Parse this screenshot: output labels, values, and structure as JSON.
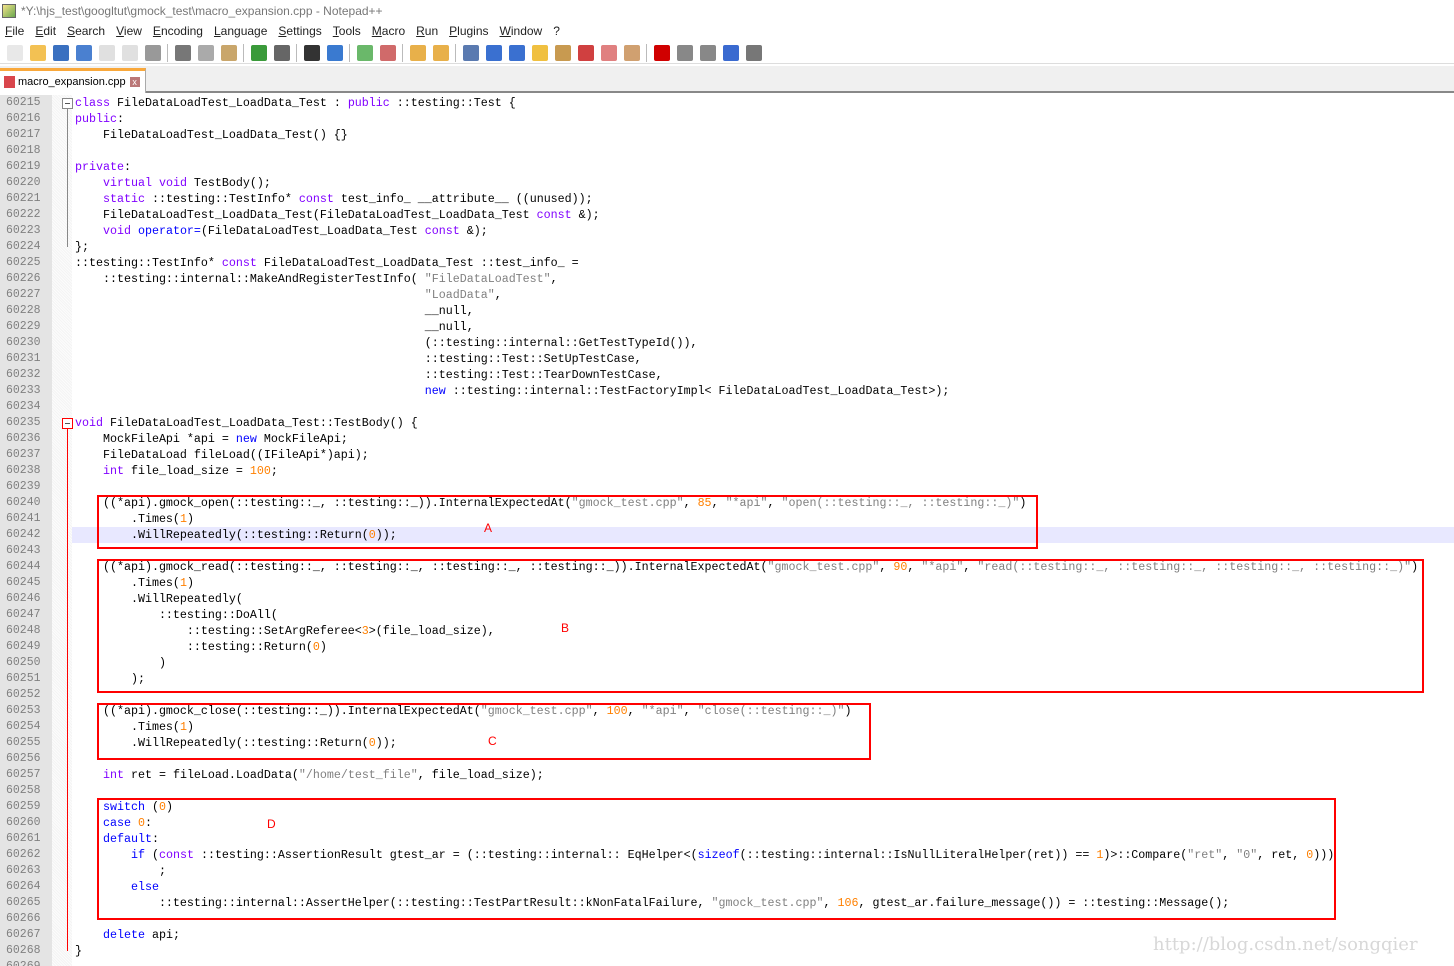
{
  "window": {
    "title": "*Y:\\hjs_test\\googltut\\gmock_test\\macro_expansion.cpp - Notepad++"
  },
  "menu": [
    "File",
    "Edit",
    "Search",
    "View",
    "Encoding",
    "Language",
    "Settings",
    "Tools",
    "Macro",
    "Run",
    "Plugins",
    "Window",
    "?"
  ],
  "toolbar": [
    {
      "icon": "new-file-icon",
      "color": "#e8e8e8"
    },
    {
      "icon": "open-file-icon",
      "color": "#f3c153"
    },
    {
      "icon": "save-icon",
      "color": "#3a70c0"
    },
    {
      "icon": "save-all-icon",
      "color": "#4a80d0"
    },
    {
      "icon": "close-icon",
      "color": "#e0e0e0"
    },
    {
      "icon": "close-all-icon",
      "color": "#e0e0e0"
    },
    {
      "icon": "print-icon",
      "color": "#999"
    },
    "|",
    {
      "icon": "cut-icon",
      "color": "#777"
    },
    {
      "icon": "copy-icon",
      "color": "#aaa"
    },
    {
      "icon": "paste-icon",
      "color": "#c9a66b"
    },
    "|",
    {
      "icon": "undo-icon",
      "color": "#3a9a3a"
    },
    {
      "icon": "redo-icon",
      "color": "#666"
    },
    "|",
    {
      "icon": "find-icon",
      "color": "#333"
    },
    {
      "icon": "replace-icon",
      "color": "#3a7ad0"
    },
    "|",
    {
      "icon": "zoom-in-icon",
      "color": "#6ab86a"
    },
    {
      "icon": "zoom-out-icon",
      "color": "#d06a6a"
    },
    "|",
    {
      "icon": "sync-vertical-icon",
      "color": "#e8b04a"
    },
    {
      "icon": "sync-horizontal-icon",
      "color": "#e8b04a"
    },
    "|",
    {
      "icon": "word-wrap-icon",
      "color": "#5a7ab0"
    },
    {
      "icon": "show-all-chars-icon",
      "color": "#3a70d0"
    },
    {
      "icon": "indent-guide-icon",
      "color": "#3a70d0"
    },
    {
      "icon": "udl-icon",
      "color": "#f0c040"
    },
    {
      "icon": "doc-map-icon",
      "color": "#c89a50"
    },
    {
      "icon": "function-list-icon",
      "color": "#d04040"
    },
    {
      "icon": "folder-workspace-icon",
      "color": "#e08080"
    },
    {
      "icon": "monitoring-icon",
      "color": "#d0a070"
    },
    "|",
    {
      "icon": "record-macro-icon",
      "color": "#d00000"
    },
    {
      "icon": "stop-record-icon",
      "color": "#888"
    },
    {
      "icon": "play-macro-icon",
      "color": "#888"
    },
    {
      "icon": "run-macro-multiple-icon",
      "color": "#3a6ad0"
    },
    {
      "icon": "save-macro-icon",
      "color": "#777"
    }
  ],
  "tab": {
    "label": "macro_expansion.cpp",
    "close": "x"
  },
  "colors": {
    "keyword": "#8000ff",
    "keyword2": "#0000ff",
    "string": "#808080",
    "number": "#ff8000",
    "highlight_box": "#ff0000",
    "current_line": "#e8e8ff"
  },
  "editor": {
    "current_line": "60242",
    "lines": [
      {
        "num": "60215",
        "segs": [
          [
            "k",
            "class"
          ],
          [
            "p",
            " FileDataLoadTest_LoadData_Test : "
          ],
          [
            "k",
            "public"
          ],
          [
            "p",
            " ::testing::Test {"
          ]
        ]
      },
      {
        "num": "60216",
        "segs": [
          [
            "k",
            "public"
          ],
          [
            "p",
            ":"
          ]
        ]
      },
      {
        "num": "60217",
        "segs": [
          [
            "p",
            "    FileDataLoadTest_LoadData_Test() {}"
          ]
        ]
      },
      {
        "num": "60218",
        "segs": []
      },
      {
        "num": "60219",
        "segs": [
          [
            "k",
            "private"
          ],
          [
            "p",
            ":"
          ]
        ]
      },
      {
        "num": "60220",
        "segs": [
          [
            "p",
            "    "
          ],
          [
            "k",
            "virtual"
          ],
          [
            "p",
            " "
          ],
          [
            "k",
            "void"
          ],
          [
            "p",
            " TestBody();"
          ]
        ]
      },
      {
        "num": "60221",
        "segs": [
          [
            "p",
            "    "
          ],
          [
            "k",
            "static"
          ],
          [
            "p",
            " ::testing::TestInfo* "
          ],
          [
            "k",
            "const"
          ],
          [
            "p",
            " test_info_ __attribute__ ((unused));"
          ]
        ]
      },
      {
        "num": "60222",
        "segs": [
          [
            "p",
            "    FileDataLoadTest_LoadData_Test(FileDataLoadTest_LoadData_Test "
          ],
          [
            "k",
            "const"
          ],
          [
            "p",
            " &);"
          ]
        ]
      },
      {
        "num": "60223",
        "segs": [
          [
            "p",
            "    "
          ],
          [
            "k",
            "void"
          ],
          [
            "p",
            " "
          ],
          [
            "b",
            "operator="
          ],
          [
            "p",
            "(FileDataLoadTest_LoadData_Test "
          ],
          [
            "k",
            "const"
          ],
          [
            "p",
            " &);"
          ]
        ]
      },
      {
        "num": "60224",
        "segs": [
          [
            "p",
            "};"
          ]
        ]
      },
      {
        "num": "60225",
        "segs": [
          [
            "p",
            "::testing::TestInfo* "
          ],
          [
            "k",
            "const"
          ],
          [
            "p",
            " FileDataLoadTest_LoadData_Test ::test_info_ ="
          ]
        ]
      },
      {
        "num": "60226",
        "segs": [
          [
            "p",
            "    ::testing::internal::MakeAndRegisterTestInfo( "
          ],
          [
            "s",
            "\"FileDataLoadTest\""
          ],
          [
            "p",
            ","
          ]
        ]
      },
      {
        "num": "60227",
        "segs": [
          [
            "p",
            "                                                  "
          ],
          [
            "s",
            "\"LoadData\""
          ],
          [
            "p",
            ","
          ]
        ]
      },
      {
        "num": "60228",
        "segs": [
          [
            "p",
            "                                                  __null,"
          ]
        ]
      },
      {
        "num": "60229",
        "segs": [
          [
            "p",
            "                                                  __null,"
          ]
        ]
      },
      {
        "num": "60230",
        "segs": [
          [
            "p",
            "                                                  (::testing::internal::GetTestTypeId()),"
          ]
        ]
      },
      {
        "num": "60231",
        "segs": [
          [
            "p",
            "                                                  ::testing::Test::SetUpTestCase,"
          ]
        ]
      },
      {
        "num": "60232",
        "segs": [
          [
            "p",
            "                                                  ::testing::Test::TearDownTestCase,"
          ]
        ]
      },
      {
        "num": "60233",
        "segs": [
          [
            "p",
            "                                                  "
          ],
          [
            "b",
            "new"
          ],
          [
            "p",
            " ::testing::internal::TestFactoryImpl< FileDataLoadTest_LoadData_Test>);"
          ]
        ]
      },
      {
        "num": "60234",
        "segs": []
      },
      {
        "num": "60235",
        "segs": [
          [
            "k",
            "void"
          ],
          [
            "p",
            " FileDataLoadTest_LoadData_Test::TestBody() {"
          ]
        ]
      },
      {
        "num": "60236",
        "segs": [
          [
            "p",
            "    MockFileApi *api = "
          ],
          [
            "b",
            "new"
          ],
          [
            "p",
            " MockFileApi;"
          ]
        ]
      },
      {
        "num": "60237",
        "segs": [
          [
            "p",
            "    FileDataLoad fileLoad((IFileApi*)api);"
          ]
        ]
      },
      {
        "num": "60238",
        "segs": [
          [
            "p",
            "    "
          ],
          [
            "k",
            "int"
          ],
          [
            "p",
            " file_load_size = "
          ],
          [
            "n",
            "100"
          ],
          [
            "p",
            ";"
          ]
        ]
      },
      {
        "num": "60239",
        "segs": []
      },
      {
        "num": "60240",
        "segs": [
          [
            "p",
            "    ((*api).gmock_open(::testing::_, ::testing::_)).InternalExpectedAt("
          ],
          [
            "s",
            "\"gmock_test.cpp\""
          ],
          [
            "p",
            ", "
          ],
          [
            "n",
            "85"
          ],
          [
            "p",
            ", "
          ],
          [
            "s",
            "\"*api\""
          ],
          [
            "p",
            ", "
          ],
          [
            "s",
            "\"open(::testing::_, ::testing::_)\""
          ],
          [
            "p",
            ")"
          ]
        ]
      },
      {
        "num": "60241",
        "segs": [
          [
            "p",
            "        .Times("
          ],
          [
            "n",
            "1"
          ],
          [
            "p",
            ")"
          ]
        ]
      },
      {
        "num": "60242",
        "segs": [
          [
            "p",
            "        .WillRepeatedly(::testing::Return("
          ],
          [
            "n",
            "0"
          ],
          [
            "p",
            "));"
          ]
        ]
      },
      {
        "num": "60243",
        "segs": []
      },
      {
        "num": "60244",
        "segs": [
          [
            "p",
            "    ((*api).gmock_read(::testing::_, ::testing::_, ::testing::_, ::testing::_)).InternalExpectedAt("
          ],
          [
            "s",
            "\"gmock_test.cpp\""
          ],
          [
            "p",
            ", "
          ],
          [
            "n",
            "90"
          ],
          [
            "p",
            ", "
          ],
          [
            "s",
            "\"*api\""
          ],
          [
            "p",
            ", "
          ],
          [
            "s",
            "\"read(::testing::_, ::testing::_, ::testing::_, ::testing::_)\""
          ],
          [
            "p",
            ")"
          ]
        ]
      },
      {
        "num": "60245",
        "segs": [
          [
            "p",
            "        .Times("
          ],
          [
            "n",
            "1"
          ],
          [
            "p",
            ")"
          ]
        ]
      },
      {
        "num": "60246",
        "segs": [
          [
            "p",
            "        .WillRepeatedly("
          ]
        ]
      },
      {
        "num": "60247",
        "segs": [
          [
            "p",
            "            ::testing::DoAll("
          ]
        ]
      },
      {
        "num": "60248",
        "segs": [
          [
            "p",
            "                ::testing::SetArgReferee<"
          ],
          [
            "n",
            "3"
          ],
          [
            "p",
            ">(file_load_size),"
          ]
        ]
      },
      {
        "num": "60249",
        "segs": [
          [
            "p",
            "                ::testing::Return("
          ],
          [
            "n",
            "0"
          ],
          [
            "p",
            ")"
          ]
        ]
      },
      {
        "num": "60250",
        "segs": [
          [
            "p",
            "            )"
          ]
        ]
      },
      {
        "num": "60251",
        "segs": [
          [
            "p",
            "        );"
          ]
        ]
      },
      {
        "num": "60252",
        "segs": []
      },
      {
        "num": "60253",
        "segs": [
          [
            "p",
            "    ((*api).gmock_close(::testing::_)).InternalExpectedAt("
          ],
          [
            "s",
            "\"gmock_test.cpp\""
          ],
          [
            "p",
            ", "
          ],
          [
            "n",
            "100"
          ],
          [
            "p",
            ", "
          ],
          [
            "s",
            "\"*api\""
          ],
          [
            "p",
            ", "
          ],
          [
            "s",
            "\"close(::testing::_)\""
          ],
          [
            "p",
            ")"
          ]
        ]
      },
      {
        "num": "60254",
        "segs": [
          [
            "p",
            "        .Times("
          ],
          [
            "n",
            "1"
          ],
          [
            "p",
            ")"
          ]
        ]
      },
      {
        "num": "60255",
        "segs": [
          [
            "p",
            "        .WillRepeatedly(::testing::Return("
          ],
          [
            "n",
            "0"
          ],
          [
            "p",
            "));"
          ]
        ]
      },
      {
        "num": "60256",
        "segs": []
      },
      {
        "num": "60257",
        "segs": [
          [
            "p",
            "    "
          ],
          [
            "k",
            "int"
          ],
          [
            "p",
            " ret = fileLoad.LoadData("
          ],
          [
            "s",
            "\"/home/test_file\""
          ],
          [
            "p",
            ", file_load_size);"
          ]
        ]
      },
      {
        "num": "60258",
        "segs": []
      },
      {
        "num": "60259",
        "segs": [
          [
            "p",
            "    "
          ],
          [
            "b",
            "switch"
          ],
          [
            "p",
            " ("
          ],
          [
            "n",
            "0"
          ],
          [
            "p",
            ")"
          ]
        ]
      },
      {
        "num": "60260",
        "segs": [
          [
            "p",
            "    "
          ],
          [
            "b",
            "case"
          ],
          [
            "p",
            " "
          ],
          [
            "n",
            "0"
          ],
          [
            "p",
            ":"
          ]
        ]
      },
      {
        "num": "60261",
        "segs": [
          [
            "p",
            "    "
          ],
          [
            "b",
            "default"
          ],
          [
            "p",
            ":"
          ]
        ]
      },
      {
        "num": "60262",
        "segs": [
          [
            "p",
            "        "
          ],
          [
            "b",
            "if"
          ],
          [
            "p",
            " ("
          ],
          [
            "k",
            "const"
          ],
          [
            "p",
            " ::testing::AssertionResult gtest_ar = (::testing::internal:: EqHelper<("
          ],
          [
            "b",
            "sizeof"
          ],
          [
            "p",
            "(::testing::internal::IsNullLiteralHelper(ret)) == "
          ],
          [
            "n",
            "1"
          ],
          [
            "p",
            ")>::Compare("
          ],
          [
            "s",
            "\"ret\""
          ],
          [
            "p",
            ", "
          ],
          [
            "s",
            "\"0\""
          ],
          [
            "p",
            ", ret, "
          ],
          [
            "n",
            "0"
          ],
          [
            "p",
            ")))"
          ]
        ]
      },
      {
        "num": "60263",
        "segs": [
          [
            "p",
            "            ;"
          ]
        ]
      },
      {
        "num": "60264",
        "segs": [
          [
            "p",
            "        "
          ],
          [
            "b",
            "else"
          ]
        ]
      },
      {
        "num": "60265",
        "segs": [
          [
            "p",
            "            ::testing::internal::AssertHelper(::testing::TestPartResult::kNonFatalFailure, "
          ],
          [
            "s",
            "\"gmock_test.cpp\""
          ],
          [
            "p",
            ", "
          ],
          [
            "n",
            "106"
          ],
          [
            "p",
            ", gtest_ar.failure_message()) = ::testing::Message();"
          ]
        ]
      },
      {
        "num": "60266",
        "segs": []
      },
      {
        "num": "60267",
        "segs": [
          [
            "p",
            "    "
          ],
          [
            "b",
            "delete"
          ],
          [
            "p",
            " api;"
          ]
        ]
      },
      {
        "num": "60268",
        "segs": [
          [
            "p",
            "}"
          ]
        ]
      },
      {
        "num": "60269",
        "segs": []
      }
    ]
  },
  "annotations": {
    "a": "A",
    "b": "B",
    "c": "C",
    "d": "D"
  },
  "watermark": "http://blog.csdn.net/songqier"
}
